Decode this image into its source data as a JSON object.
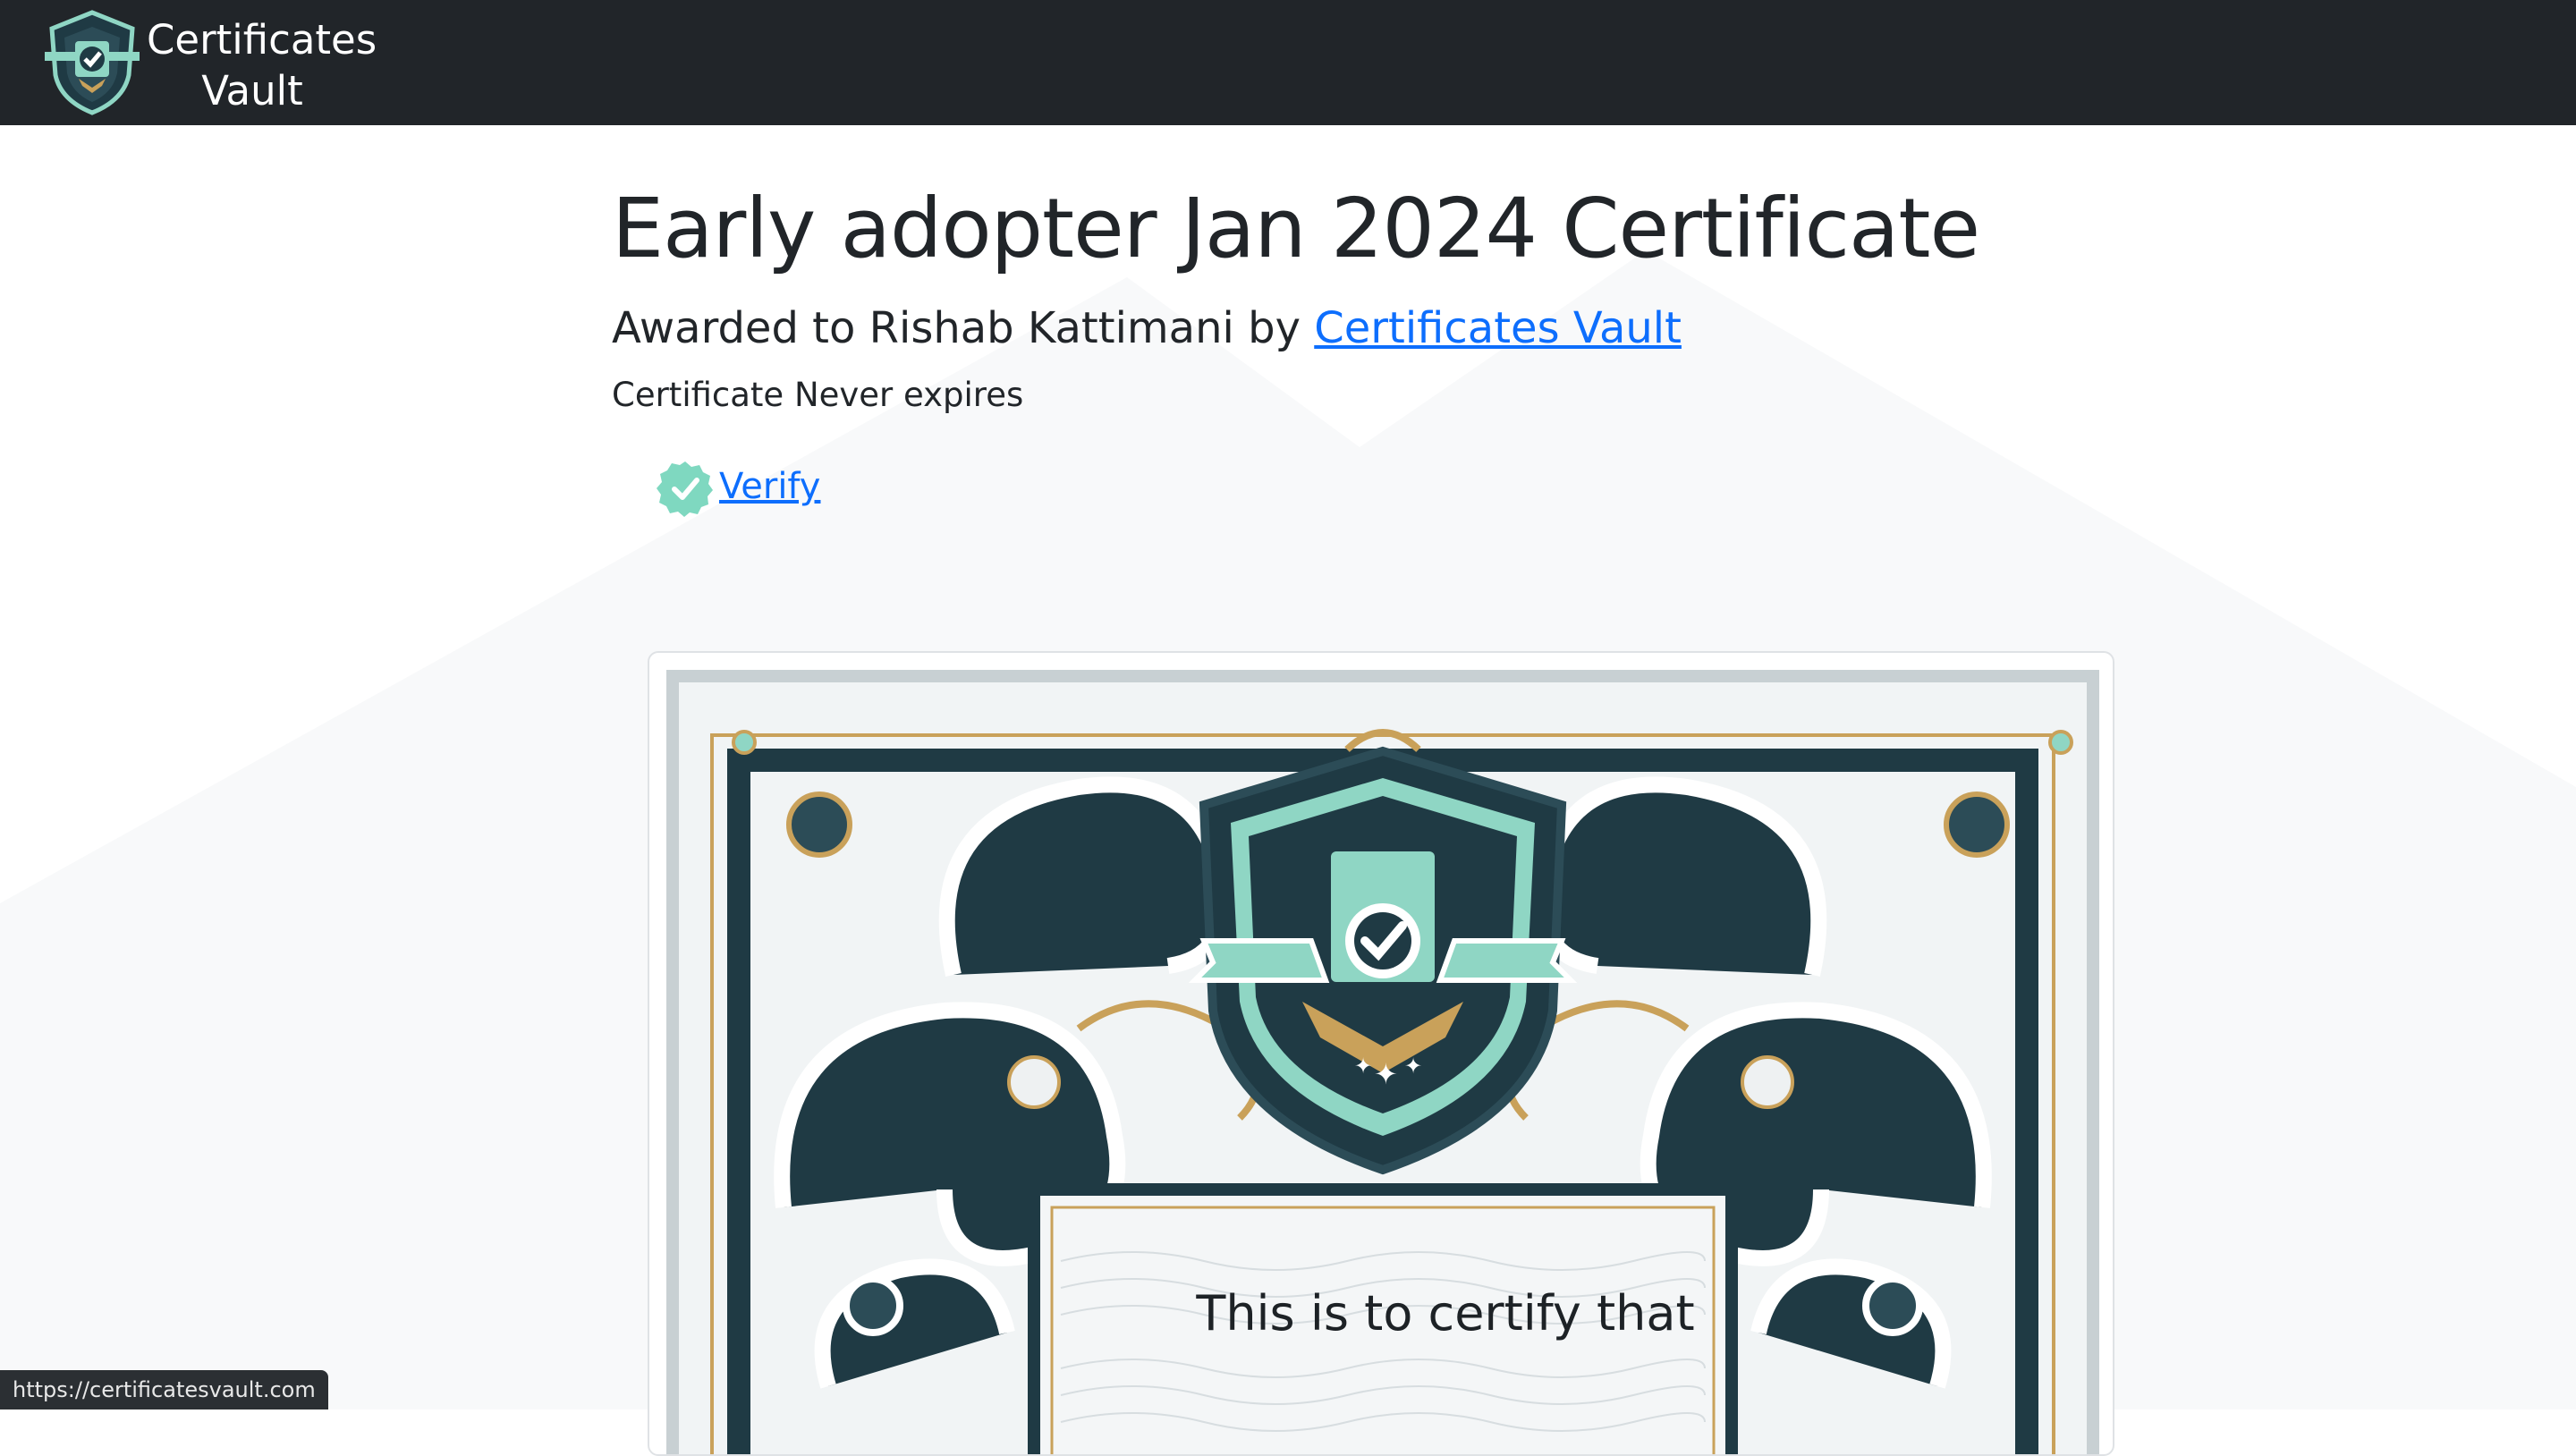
{
  "navbar": {
    "brand_line1": "Certificates",
    "brand_line2": "Vault",
    "logo_icon": "shield-check-icon"
  },
  "certificate": {
    "title": "Early adopter Jan 2024 Certificate",
    "awarded_prefix": "Awarded to Rishab Kattimani by ",
    "issuer_link": "Certificates Vault",
    "expiry": "Certificate Never expires",
    "verify_label": "Verify",
    "verify_icon": "verified-badge-icon",
    "image_text": "This is to certify that"
  },
  "status_bar": {
    "url": "https://certificatesvault.com"
  },
  "colors": {
    "navbar_bg": "#212529",
    "link": "#0d6efd",
    "verify_badge": "#7fd8c0",
    "teal_accent": "#8fd6c4",
    "dark_teal": "#1f3a44",
    "gold": "#c9a15a"
  }
}
